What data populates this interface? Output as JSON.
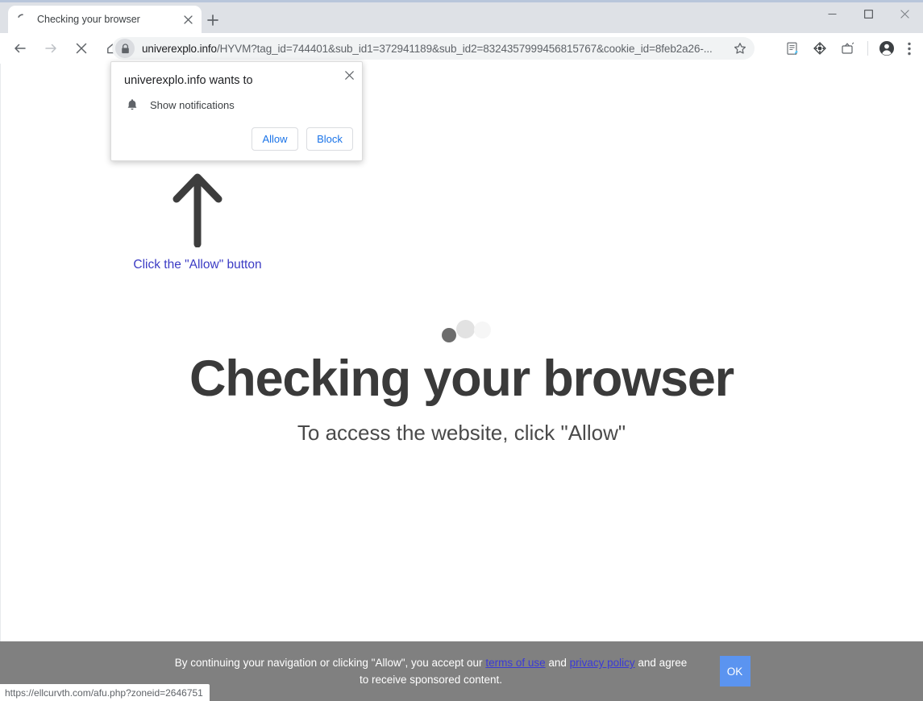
{
  "window": {
    "minimize_label": "Minimize",
    "maximize_label": "Maximize",
    "close_label": "Close"
  },
  "tabstrip": {
    "tab_title": "Checking your browser",
    "tab_close_label": "Close tab",
    "new_tab_label": "New tab"
  },
  "toolbar": {
    "back_label": "Back",
    "forward_label": "Forward",
    "stop_label": "Stop",
    "home_label": "Home",
    "url_domain": "univerexplo.info",
    "url_path": "/HYVM?tag_id=744401&sub_id1=372941189&sub_id2=8324357999456815767&cookie_id=8feb2a26-...",
    "url_full": "univerexplo.info/HYVM?tag_id=744401&sub_id1=372941189&sub_id2=8324357999456815767&cookie_id=8feb2a26-...",
    "bookmark_label": "Bookmark this tab",
    "lock_label": "View site information",
    "extension_1_label": "Notes extension",
    "extension_2_label": "Extension",
    "extension_3_label": "Cast / Media extension",
    "profile_label": "Profile",
    "menu_label": "Customize and control Google Chrome"
  },
  "permission_bubble": {
    "title": "univerexplo.info wants to",
    "request_label": "Show notifications",
    "allow_label": "Allow",
    "block_label": "Block",
    "close_label": "Close"
  },
  "page": {
    "arrow_hint": "Click the \"Allow\" button",
    "headline": "Checking your browser",
    "subhead": "To access the website, click \"Allow\"",
    "consent": {
      "text_before_terms": "By continuing your navigation or clicking \"Allow\", you accept our ",
      "terms_link": "terms of use",
      "text_between": " and ",
      "privacy_link": "privacy policy",
      "text_after": " and agree to receive sponsored content.",
      "ok_label": "OK"
    }
  },
  "status": {
    "link_url": "https://ellcurvth.com/afu.php?zoneid=2646751"
  },
  "colors": {
    "tabstrip_bg": "#dee1e6",
    "omnibox_bg": "#f1f3f4",
    "hint_text": "#3b3bc4",
    "headline": "#3a3a3a",
    "banner_bg": "#808080",
    "ok_button": "#5b94f0",
    "link": "#3a3ad6",
    "permission_accent": "#1a73e8"
  }
}
